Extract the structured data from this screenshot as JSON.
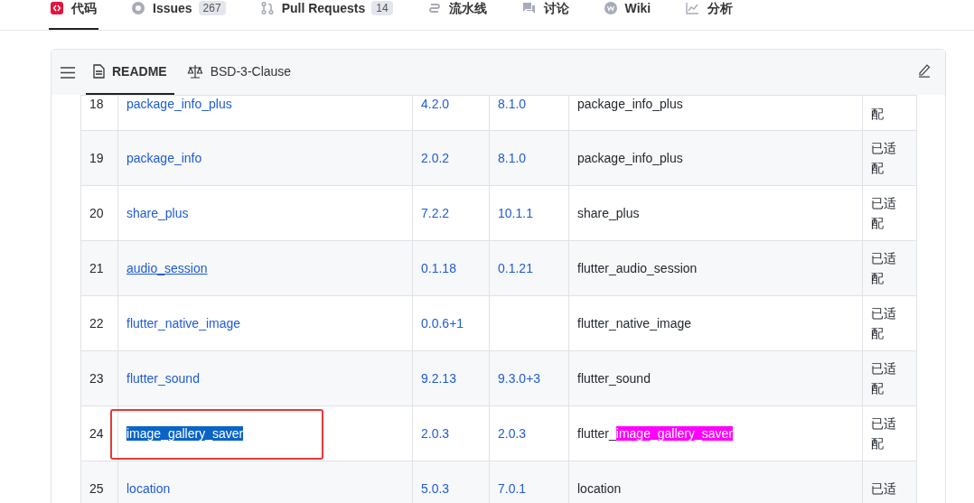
{
  "nav_tabs": [
    {
      "label": "代码",
      "selected": true
    },
    {
      "label": "Issues",
      "count": "267",
      "selected": false
    },
    {
      "label": "Pull Requests",
      "count": "14",
      "selected": false
    },
    {
      "label": "流水线",
      "selected": false
    },
    {
      "label": "讨论",
      "selected": false
    },
    {
      "label": "Wiki",
      "selected": false
    },
    {
      "label": "分析",
      "selected": false
    }
  ],
  "readme_tabs": [
    {
      "label": "README",
      "selected": true
    },
    {
      "label": "BSD-3-Clause",
      "selected": false
    }
  ],
  "table": {
    "rows": [
      {
        "index": "18",
        "package": "package_info_plus",
        "version": "4.2.0",
        "latest": "8.1.0",
        "replacement": "package_info_plus",
        "status": "配",
        "partial": true
      },
      {
        "index": "19",
        "package": "package_info",
        "version": "2.0.2",
        "latest": "8.1.0",
        "replacement": "package_info_plus",
        "status": "已适配"
      },
      {
        "index": "20",
        "package": "share_plus",
        "version": "7.2.2",
        "latest": "10.1.1",
        "replacement": "share_plus",
        "status": "已适配"
      },
      {
        "index": "21",
        "package": "audio_session",
        "version": "0.1.18",
        "latest": "0.1.21",
        "replacement": "flutter_audio_session",
        "status": "已适配",
        "hovered": true
      },
      {
        "index": "22",
        "package": "flutter_native_image",
        "version": "0.0.6+1",
        "replacement": "flutter_native_image",
        "status": "已适配"
      },
      {
        "index": "23",
        "package": "flutter_sound",
        "version": "9.2.13",
        "latest": "9.3.0+3",
        "replacement": "flutter_sound",
        "status": "已适配"
      },
      {
        "index": "24",
        "package": "image_gallery_saver",
        "version": "2.0.3",
        "latest": "2.0.3",
        "replacement": "flutter_",
        "replacement_highlight": "image_gallery_saver",
        "status": "已适配",
        "selected": true,
        "annotated": true
      },
      {
        "index": "25",
        "package": "location",
        "version": "5.0.3",
        "latest": "7.0.1",
        "replacement": "location",
        "status": "已适"
      }
    ]
  }
}
